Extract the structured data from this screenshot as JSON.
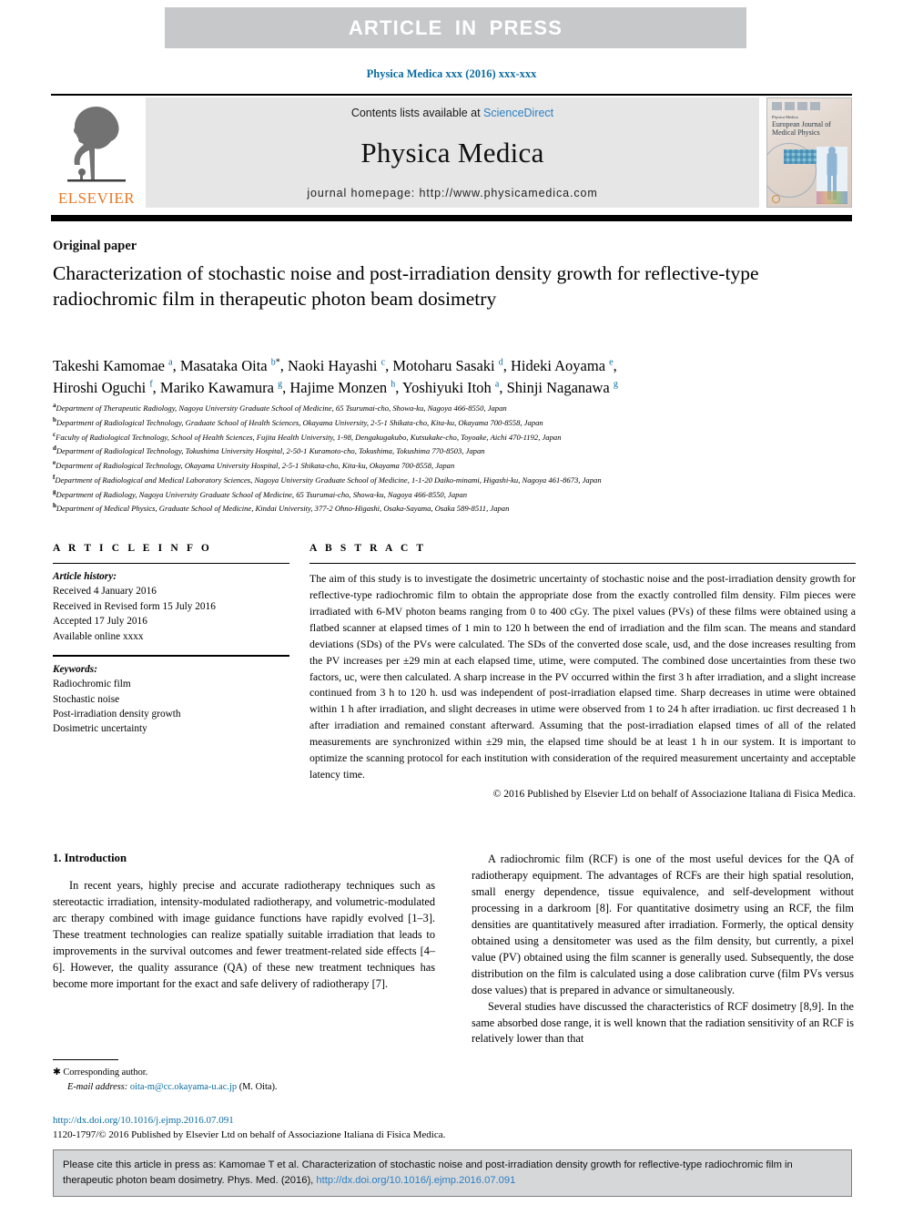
{
  "banner": {
    "text": "ARTICLE  IN  PRESS",
    "bg": "#c7c8ca",
    "fg": "#ffffff"
  },
  "running_head": "Physica Medica xxx (2016) xxx-xxx",
  "masthead": {
    "contents_prefix": "Contents lists available at ",
    "sciencedirect": "ScienceDirect",
    "journal_name": "Physica Medica",
    "homepage": "journal homepage: http://www.physicamedica.com",
    "publisher_word": "ELSEVIER",
    "cover_title_small": "Physica Medica",
    "cover_title_big": "European Journal of Medical Physics"
  },
  "article": {
    "type": "Original paper",
    "title": "Characterization of stochastic noise and post-irradiation density growth for reflective-type radiochromic film in therapeutic photon beam dosimetry",
    "authors_line_1": "Takeshi Kamomae a, Masataka Oita b*, Naoki Hayashi c, Motoharu Sasaki d, Hideki Aoyama e,",
    "authors_line_2": "Hiroshi Oguchi f, Mariko Kawamura g, Hajime Monzen h, Yoshiyuki Itoh a, Shinji Naganawa g",
    "affiliations": [
      {
        "mark": "a",
        "text": "Department of Therapeutic Radiology, Nagoya University Graduate School of Medicine, 65 Tsurumai-cho, Showa-ku, Nagoya 466-8550, Japan"
      },
      {
        "mark": "b",
        "text": "Department of Radiological Technology, Graduate School of Health Sciences, Okayama University, 2-5-1 Shikata-cho, Kita-ku, Okayama 700-8558, Japan"
      },
      {
        "mark": "c",
        "text": "Faculty of Radiological Technology, School of Health Sciences, Fujita Health University, 1-98, Dengakugakubo, Kutsukake-cho, Toyoake, Aichi 470-1192, Japan"
      },
      {
        "mark": "d",
        "text": "Department of Radiological Technology, Tokushima University Hospital, 2-50-1 Kuramoto-cho, Tokushima, Tokushima 770-8503, Japan"
      },
      {
        "mark": "e",
        "text": "Department of Radiological Technology, Okayama University Hospital, 2-5-1 Shikata-cho, Kita-ku, Okayama 700-8558, Japan"
      },
      {
        "mark": "f",
        "text": "Department of Radiological and Medical Laboratory Sciences, Nagoya University Graduate School of Medicine, 1-1-20 Daiko-minami, Higashi-ku, Nagoya 461-8673, Japan"
      },
      {
        "mark": "g",
        "text": "Department of Radiology, Nagoya University Graduate School of Medicine, 65 Tsurumai-cho, Showa-ku, Nagoya 466-8550, Japan"
      },
      {
        "mark": "h",
        "text": "Department of Medical Physics, Graduate School of Medicine, Kindai University, 377-2 Ohno-Higashi, Osaka-Sayama, Osaka 589-8511, Japan"
      }
    ]
  },
  "article_info": {
    "heading": "A R T I C L E   I N F O",
    "history_label": "Article history:",
    "history": [
      "Received 4 January 2016",
      "Received in Revised form 15 July 2016",
      "Accepted 17 July 2016",
      "Available online xxxx"
    ],
    "keywords_label": "Keywords:",
    "keywords": [
      "Radiochromic film",
      "Stochastic noise",
      "Post-irradiation density growth",
      "Dosimetric uncertainty"
    ]
  },
  "abstract": {
    "heading": "A B S T R A C T",
    "text": "The aim of this study is to investigate the dosimetric uncertainty of stochastic noise and the post-irradiation density growth for reflective-type radiochromic film to obtain the appropriate dose from the exactly controlled film density. Film pieces were irradiated with 6-MV photon beams ranging from 0 to 400 cGy. The pixel values (PVs) of these films were obtained using a flatbed scanner at elapsed times of 1 min to 120 h between the end of irradiation and the film scan. The means and standard deviations (SDs) of the PVs were calculated. The SDs of the converted dose scale, usd, and the dose increases resulting from the PV increases per ±29 min at each elapsed time, utime, were computed. The combined dose uncertainties from these two factors, uc, were then calculated. A sharp increase in the PV occurred within the first 3 h after irradiation, and a slight increase continued from 3 h to 120 h. usd was independent of post-irradiation elapsed time. Sharp decreases in utime were obtained within 1 h after irradiation, and slight decreases in utime were observed from 1 to 24 h after irradiation. uc first decreased 1 h after irradiation and remained constant afterward. Assuming that the post-irradiation elapsed times of all of the related measurements are synchronized within ±29 min, the elapsed time should be at least 1 h in our system. It is important to optimize the scanning protocol for each institution with consideration of the required measurement uncertainty and acceptable latency time.",
    "copyright": "© 2016 Published by Elsevier Ltd on behalf of Associazione Italiana di Fisica Medica."
  },
  "introduction": {
    "heading": "1. Introduction",
    "left_paragraph": "In recent years, highly precise and accurate radiotherapy techniques such as stereotactic irradiation, intensity-modulated radiotherapy, and volumetric-modulated arc therapy combined with image guidance functions have rapidly evolved [1–3]. These treatment technologies can realize spatially suitable irradiation that leads to improvements in the survival outcomes and fewer treatment-related side effects [4–6]. However, the quality assurance (QA) of these new treatment techniques has become more important for the exact and safe delivery of radiotherapy [7].",
    "right_paragraph_1": "A radiochromic film (RCF) is one of the most useful devices for the QA of radiotherapy equipment. The advantages of RCFs are their high spatial resolution, small energy dependence, tissue equivalence, and self-development without processing in a darkroom [8]. For quantitative dosimetry using an RCF, the film densities are quantitatively measured after irradiation. Formerly, the optical density obtained using a densitometer was used as the film density, but currently, a pixel value (PV) obtained using the film scanner is generally used. Subsequently, the dose distribution on the film is calculated using a dose calibration curve (film PVs versus dose values) that is prepared in advance or simultaneously.",
    "right_paragraph_2": "Several studies have discussed the characteristics of RCF dosimetry [8,9]. In the same absorbed dose range, it is well known that the radiation sensitivity of an RCF is relatively lower than that"
  },
  "footnote": {
    "corresponding": "Corresponding author.",
    "email_label": "E-mail address:",
    "email": "oita-m@cc.okayama-u.ac.jp",
    "email_owner": "(M. Oita)."
  },
  "doi_block": {
    "doi_url": "http://dx.doi.org/10.1016/j.ejmp.2016.07.091",
    "issn_line": "1120-1797/© 2016 Published by Elsevier Ltd on behalf of Associazione Italiana di Fisica Medica."
  },
  "citation_box": {
    "text_before": "Please cite this article in press as: Kamomae T et al. Characterization of stochastic noise and post-irradiation density growth for reflective-type radiochromic film in therapeutic photon beam dosimetry. Phys. Med. (2016), ",
    "doi": "http://dx.doi.org/10.1016/j.ejmp.2016.07.091"
  },
  "colors": {
    "link_blue": "#0b6ba0",
    "elsevier_orange": "#e87722",
    "banner_gray": "#c7c8ca",
    "box_gray": "#d6d7d8"
  }
}
